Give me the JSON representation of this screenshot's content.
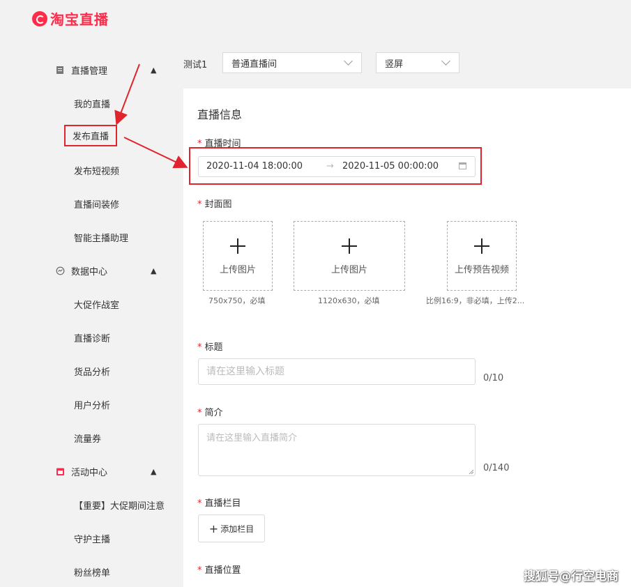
{
  "brand": {
    "name": "淘宝直播",
    "color": "#ff2b4a"
  },
  "sidebar": {
    "groups": [
      {
        "label": "直播管理",
        "icon": "document-icon",
        "expanded": true,
        "items": [
          "我的直播",
          "发布直播",
          "发布短视频",
          "直播间装修",
          "智能主播助理"
        ]
      },
      {
        "label": "数据中心",
        "icon": "clock-icon",
        "expanded": true,
        "items": [
          "大促作战室",
          "直播诊断",
          "货品分析",
          "用户分析",
          "流量券"
        ]
      },
      {
        "label": "活动中心",
        "icon": "calendar-icon",
        "expanded": true,
        "items": [
          "【重要】大促期间注意",
          "守护主播",
          "粉丝榜单"
        ]
      }
    ],
    "selected": "发布直播"
  },
  "topbar": {
    "account": "测试1",
    "room_type": "普通直播间",
    "orientation": "竖屏"
  },
  "form": {
    "title": "直播信息",
    "time": {
      "label": "直播时间",
      "start": "2020-11-04 18:00:00",
      "end": "2020-11-05 00:00:00",
      "separator": "→"
    },
    "cover": {
      "label": "封面图",
      "uploads": [
        {
          "label": "上传图片",
          "hint": "750x750，必填"
        },
        {
          "label": "上传图片",
          "hint": "1120x630，必填"
        },
        {
          "label": "上传预告视频",
          "hint": "比例16:9，非必填，上传2..."
        }
      ]
    },
    "headline": {
      "label": "标题",
      "placeholder": "请在这里输入标题",
      "counter": "0/10"
    },
    "intro": {
      "label": "简介",
      "placeholder": "请在这里输入直播简介",
      "counter": "0/140"
    },
    "column": {
      "label": "直播栏目",
      "button": "添加栏目"
    },
    "location": {
      "label": "直播位置"
    },
    "required_mark": "*"
  },
  "annotation_color": "#e0232c",
  "watermark": "搜狐号@行空电商"
}
